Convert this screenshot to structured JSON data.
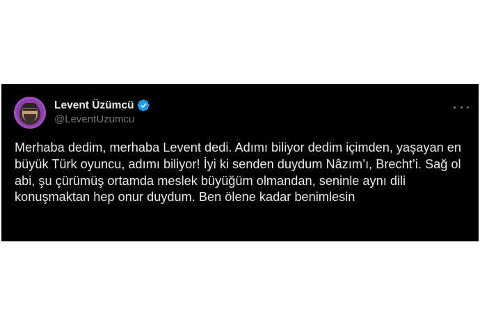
{
  "tweet": {
    "author": {
      "display_name": "Levent Üzümcü",
      "handle": "@LeventUzumcu",
      "verified": true
    },
    "text": "Merhaba dedim, merhaba Levent dedi. Adımı biliyor dedim içimden, yaşayan en büyük Türk oyuncu, adımı biliyor! İyi ki senden duydum Nâzım’ı, Brecht’i. Sağ ol abi, şu çürümüş ortamda meslek büyüğüm olmandan, seninle aynı dili konuşmaktan hep onur duydum. Ben ölene kadar benimlesin"
  },
  "colors": {
    "background": "#000000",
    "text": "#e7e9ea",
    "muted": "#71767b",
    "verified_badge": "#1d9bf0"
  },
  "icons": {
    "verified": "verified-badge-icon",
    "more": "more-options-icon"
  }
}
